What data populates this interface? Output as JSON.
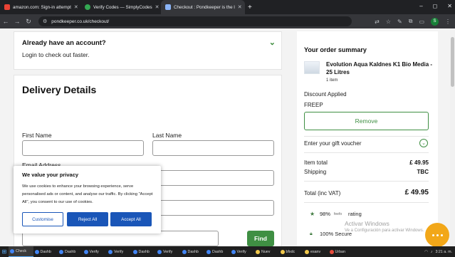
{
  "browser": {
    "tabs": [
      {
        "title": "amazon.com: Sign-in attempt",
        "favicon_color": "#ea4335",
        "icon": "gmail-icon"
      },
      {
        "title": "Verify Codes — SimplyCodes",
        "favicon_color": "#34a853",
        "icon": "simplycodes-icon"
      },
      {
        "title": "Checkout : Pondkeeper is the l",
        "favicon_color": "#8ab4f8",
        "icon": "pondkeeper-icon"
      }
    ],
    "new_tab": "+",
    "window_controls": [
      "–",
      "◻",
      "✕"
    ],
    "url": "pondkeeper.co.uk/checkout/",
    "profile_initial": "S"
  },
  "login": {
    "title": "Already have an account?",
    "subtitle": "Login to check out faster."
  },
  "delivery": {
    "title": "Delivery Details",
    "first_name_label": "First Name",
    "last_name_label": "Last Name",
    "email_label": "Email Address",
    "find_button": "Find"
  },
  "privacy": {
    "title": "We value your privacy",
    "text": "We use cookies to enhance your browsing experience, serve personalised ads or content, and analyse our traffic. By clicking \"Accept All\", you consent to our use of cookies.",
    "customise": "Customise",
    "reject": "Reject All",
    "accept": "Accept All"
  },
  "summary": {
    "title": "Your order summary",
    "product_name": "Evolution Aqua Kaldnes K1 Bio Media - 25 Litres",
    "product_qty": "1 item",
    "discount_label": "Discount Applied",
    "discount_code": "FREEP",
    "remove_button": "Remove",
    "voucher_label": "Enter your gift voucher",
    "item_total_label": "Item total",
    "item_total_value": "£ 49.95",
    "shipping_label": "Shipping",
    "shipping_value": "TBC",
    "total_label": "Total (inc VAT)",
    "total_value": "£ 49.95",
    "rating_pct": "98%",
    "rating_brand": "feefo",
    "rating_word": "rating",
    "secure_text": "100% Secure"
  },
  "watermark": {
    "line1": "Activar Windows",
    "line2": "Ve a Configuración para activar Windows."
  },
  "taskbar": {
    "items": [
      "Check",
      "Dashb",
      "Dashb",
      "Verify",
      "Verify",
      "Dashb",
      "Verify",
      "Dashb",
      "Dashb",
      "Verify",
      "Nuev",
      "bfxdc",
      "esanv",
      "Urban"
    ],
    "time": "3:21 a. m.",
    "colors": {
      "accent": "#5ab0ff"
    }
  },
  "colors": {
    "green": "#3f8f43",
    "blue_button": "#1a56b8",
    "chat": "#f2a719"
  }
}
